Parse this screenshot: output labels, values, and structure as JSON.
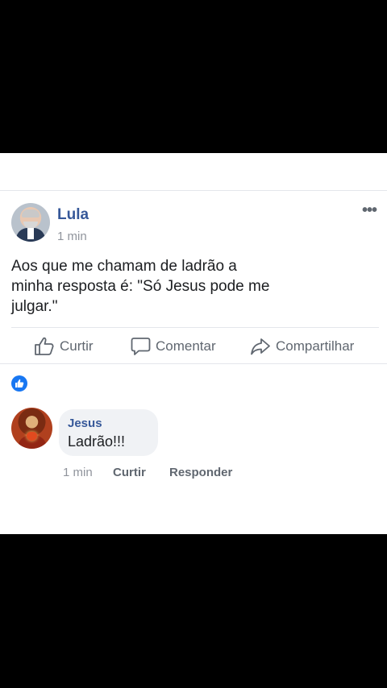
{
  "post": {
    "author": "Lula",
    "time": "1 min",
    "more_label": "•••",
    "text": "Aos que me chamam de ladrão a minha resposta é: \"Só Jesus pode me julgar.\""
  },
  "actions": {
    "like": "Curtir",
    "comment": "Comentar",
    "share": "Compartilhar"
  },
  "comment": {
    "author": "Jesus",
    "text": "Ladrão!!!",
    "time": "1 min",
    "like": "Curtir",
    "reply": "Responder"
  },
  "colors": {
    "brand_link": "#365899",
    "like_blue": "#1877f2",
    "muted": "#606770"
  },
  "icons": [
    "like-icon",
    "comment-icon",
    "share-icon",
    "like-reaction-icon",
    "more-icon"
  ]
}
